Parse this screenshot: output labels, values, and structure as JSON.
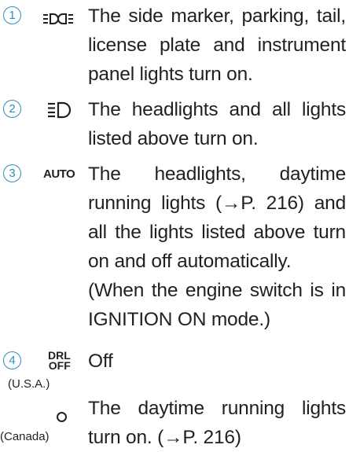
{
  "items": [
    {
      "number": "1",
      "icon": "side-marker-lights-icon",
      "text": "The side marker, parking, tail, license plate and instrument panel lights turn on."
    },
    {
      "number": "2",
      "icon": "headlight-icon",
      "text": "The headlights and all lights listed above turn on."
    },
    {
      "number": "3",
      "icon_text": "AUTO",
      "text": "The headlights, daytime running lights (→P. 216) and all the lights listed above turn on and off automatically.",
      "note": "(When the engine switch is in IGNITION ON mode.)"
    },
    {
      "number": "4",
      "icon_text_top": "DRL",
      "icon_text_bottom": "OFF",
      "text": "Off",
      "region": "(U.S.A.)"
    },
    {
      "icon": "circle-o-icon",
      "text": "The daytime running lights turn on. (→P. 216)",
      "region": "(Canada)"
    }
  ],
  "colors": {
    "accent": "#2a8fbf",
    "text": "#231f20"
  }
}
